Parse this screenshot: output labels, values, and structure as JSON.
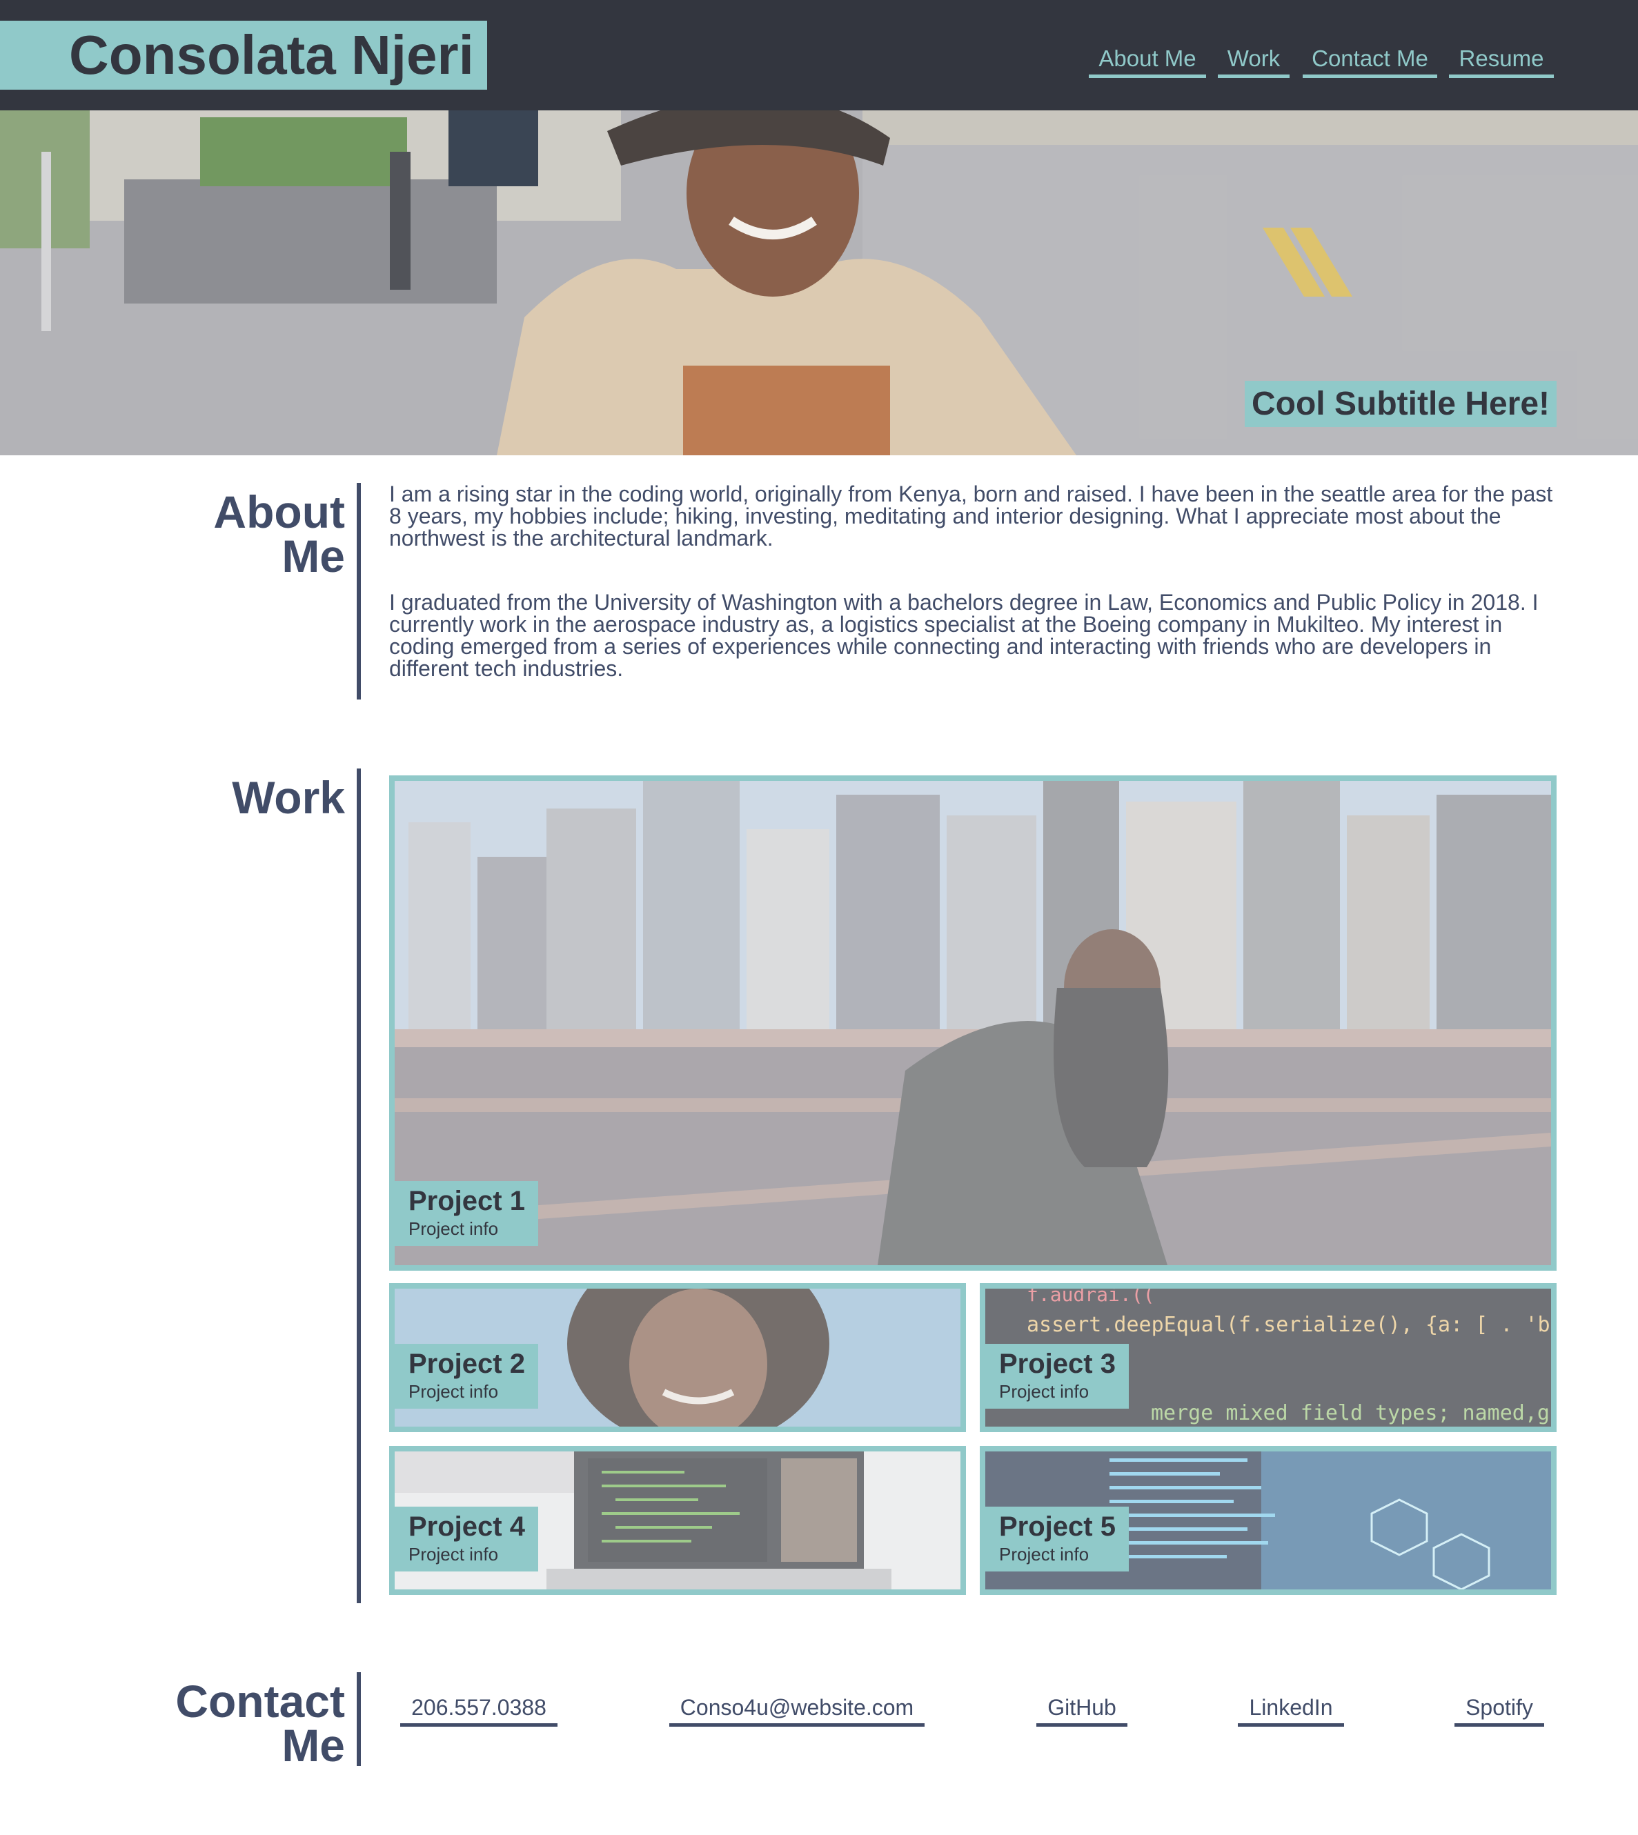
{
  "header": {
    "name": "Consolata Njeri",
    "nav": [
      {
        "label": "About Me"
      },
      {
        "label": "Work"
      },
      {
        "label": "Contact Me"
      },
      {
        "label": "Resume"
      }
    ]
  },
  "hero": {
    "subtitle": "Cool Subtitle Here!"
  },
  "about": {
    "title_line1": "About",
    "title_line2": "Me",
    "paragraphs": [
      "I am a rising star in the coding world, originally from Kenya, born and raised. I have been in the seattle area for the past 8 years, my hobbies include; hiking, investing, meditating and interior designing. What I appreciate most about the northwest is the architectural landmark.",
      "I graduated from the University of Washington with a bachelors degree in Law, Economics and Public Policy in 2018. I currently work in the aerospace industry as, a logistics specialist at the Boeing company in Mukilteo. My interest in coding emerged from a series of experiences while connecting and interacting with friends who are developers in different tech industries."
    ]
  },
  "work": {
    "title": "Work",
    "projects": [
      {
        "name": "Project 1",
        "info": "Project info"
      },
      {
        "name": "Project 2",
        "info": "Project info"
      },
      {
        "name": "Project 3",
        "info": "Project info"
      },
      {
        "name": "Project 4",
        "info": "Project info"
      },
      {
        "name": "Project 5",
        "info": "Project info"
      }
    ],
    "card3_code_lines": [
      "f.audrai.((",
      "assert.deepEqual(f.serialize(), {a: [ . 'b'",
      "merge mixed field types; named,guot"
    ]
  },
  "contact": {
    "title_line1": "Contact",
    "title_line2": "Me",
    "links": [
      {
        "label": "206.557.0388"
      },
      {
        "label": "Conso4u@website.com"
      },
      {
        "label": "GitHub"
      },
      {
        "label": "LinkedIn"
      },
      {
        "label": "Spotify"
      }
    ]
  },
  "colors": {
    "accent": "#90c9c9",
    "dark": "#33363f",
    "text": "#414c68"
  }
}
